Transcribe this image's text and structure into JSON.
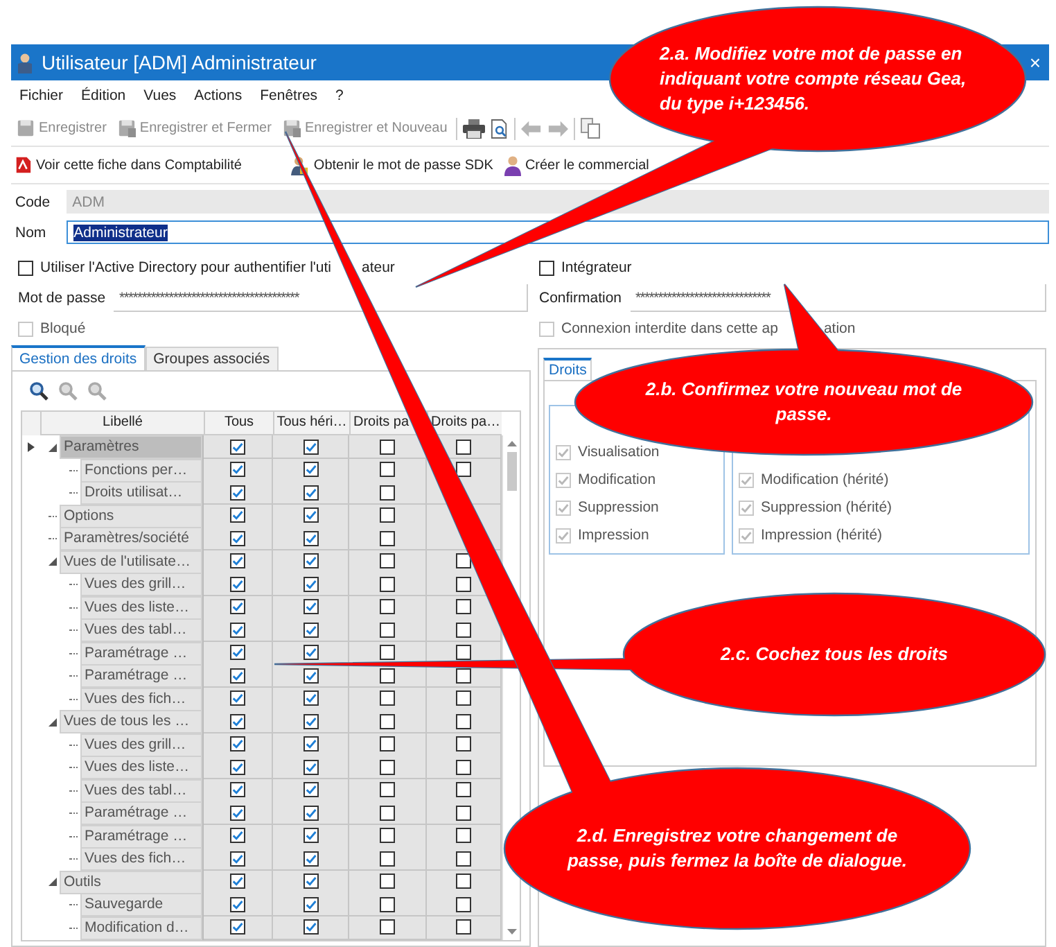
{
  "window": {
    "title": "Utilisateur [ADM] Administrateur",
    "close": "×"
  },
  "menu": [
    "Fichier",
    "Édition",
    "Vues",
    "Actions",
    "Fenêtres",
    "?"
  ],
  "toolbar": [
    {
      "label": "Enregistrer",
      "disabled": true
    },
    {
      "label": "Enregistrer et Fermer",
      "disabled": true
    },
    {
      "label": "Enregistrer et Nouveau",
      "disabled": true
    }
  ],
  "actions": [
    "Voir cette fiche dans Comptabilité",
    "Obtenir le mot de passe SDK",
    "Créer le commercial"
  ],
  "form": {
    "code_label": "Code",
    "code": "ADM",
    "name_label": "Nom",
    "name": "Administrateur",
    "active_directory": {
      "label": "Utiliser l'Active Directory pour authentifier l'uti",
      "label_tail": "ateur",
      "checked": false
    },
    "integrator": {
      "label": "Intégrateur",
      "checked": false
    },
    "password_label": "Mot de passe",
    "password": "****************************************",
    "confirm_label": "Confirmation",
    "confirm": "******************************",
    "blocked": {
      "label": "Bloqué",
      "checked": false,
      "disabled": true
    },
    "no_login": {
      "label": "Connexion interdite dans cette ap",
      "label_tail": "ation",
      "checked": false,
      "disabled": true
    }
  },
  "tabs": [
    {
      "label": "Gestion des droits",
      "selected": true
    },
    {
      "label": "Groupes associés",
      "selected": false
    }
  ],
  "grid": {
    "columns": [
      "Libellé",
      "Tous",
      "Tous héri…",
      "Droits pa",
      "Droits pa…"
    ],
    "rows": [
      {
        "label": "Paramètres",
        "selected": true,
        "checks": [
          true,
          true,
          false,
          false
        ],
        "children": [
          {
            "label": "Fonctions per…",
            "selected": false,
            "checks": [
              true,
              true,
              false,
              false
            ]
          },
          {
            "label": "Droits utilisat…",
            "selected": false,
            "checks": [
              true,
              true,
              false
            ]
          }
        ]
      },
      {
        "label": "Options",
        "selected": false,
        "checks": [
          true,
          true,
          false
        ]
      },
      {
        "label": "Paramètres/société",
        "selected": false,
        "checks": [
          true,
          true,
          false
        ]
      },
      {
        "label": "Vues de l'utilisate…",
        "selected": false,
        "checks": [
          true,
          true,
          false,
          false
        ],
        "children": [
          {
            "label": "Vues des grill…",
            "selected": false,
            "checks": [
              true,
              true,
              false,
              false
            ]
          },
          {
            "label": "Vues des liste…",
            "selected": false,
            "checks": [
              true,
              true,
              false,
              false
            ]
          },
          {
            "label": "Vues des tabl…",
            "selected": false,
            "checks": [
              true,
              true,
              false,
              false
            ]
          },
          {
            "label": "Paramétrage …",
            "selected": false,
            "checks": [
              true,
              true,
              false,
              false
            ]
          },
          {
            "label": "Paramétrage …",
            "selected": false,
            "checks": [
              true,
              true,
              false,
              false
            ]
          },
          {
            "label": "Vues des fich…",
            "selected": false,
            "checks": [
              true,
              true,
              false,
              false
            ]
          }
        ]
      },
      {
        "label": "Vues de tous les …",
        "selected": false,
        "checks": [
          true,
          true,
          false,
          false
        ],
        "children": [
          {
            "label": "Vues des grill…",
            "selected": false,
            "checks": [
              true,
              true,
              false,
              false
            ]
          },
          {
            "label": "Vues des liste…",
            "selected": false,
            "checks": [
              true,
              true,
              false,
              false
            ]
          },
          {
            "label": "Vues des tabl…",
            "selected": false,
            "checks": [
              true,
              true,
              false,
              false
            ]
          },
          {
            "label": "Paramétrage …",
            "selected": false,
            "checks": [
              true,
              true,
              false,
              false
            ]
          },
          {
            "label": "Paramétrage …",
            "selected": false,
            "checks": [
              true,
              true,
              false,
              false
            ]
          },
          {
            "label": "Vues des fich…",
            "selected": false,
            "checks": [
              true,
              true,
              false,
              false
            ]
          }
        ]
      },
      {
        "label": "Outils",
        "selected": false,
        "checks": [
          true,
          true,
          false,
          false
        ],
        "children": [
          {
            "label": "Sauvegarde",
            "selected": false,
            "checks": [
              true,
              true,
              false,
              false
            ]
          },
          {
            "label": "Modification d…",
            "selected": false,
            "checks": [
              true,
              true,
              false,
              false
            ]
          }
        ]
      }
    ]
  },
  "rights": {
    "tabs": [
      {
        "label": "Droits",
        "selected": true
      }
    ],
    "groups": [
      [
        {
          "label": "Visualisation",
          "checked": true
        },
        {
          "label": "Modification",
          "checked": true
        },
        {
          "label": "Suppression",
          "checked": true
        },
        {
          "label": "Impression",
          "checked": true
        }
      ],
      [
        {
          "label": "Modification (hérité)",
          "checked": true
        },
        {
          "label": "Suppression (hérité)",
          "checked": true
        },
        {
          "label": "Impression (hérité)",
          "checked": true
        }
      ]
    ]
  },
  "callouts": [
    {
      "text": "2.a. Modifiez votre mot de passe en indiquant votre compte réseau Gea, du type i+123456."
    },
    {
      "text": "2.b. Confirmez votre nouveau mot de passe."
    },
    {
      "text": "2.c. Cochez tous les droits"
    },
    {
      "text": "2.d. Enregistrez votre changement de passe, puis fermez la boîte de dialogue."
    }
  ]
}
